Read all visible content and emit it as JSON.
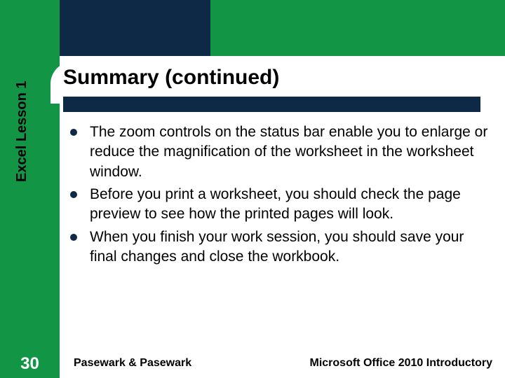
{
  "sidebar": {
    "label": "Excel Lesson 1"
  },
  "slide_number": "30",
  "title": "Summary (continued)",
  "bullets": [
    "The zoom controls on the status bar enable you to enlarge or reduce the magnification of the worksheet in the worksheet window.",
    "Before you print a worksheet, you should check the page preview to see how the printed pages will look.",
    "When you finish your work session, you should save your final changes and close the workbook."
  ],
  "footer": {
    "left": "Pasewark & Pasewark",
    "right": "Microsoft Office 2010 Introductory"
  }
}
